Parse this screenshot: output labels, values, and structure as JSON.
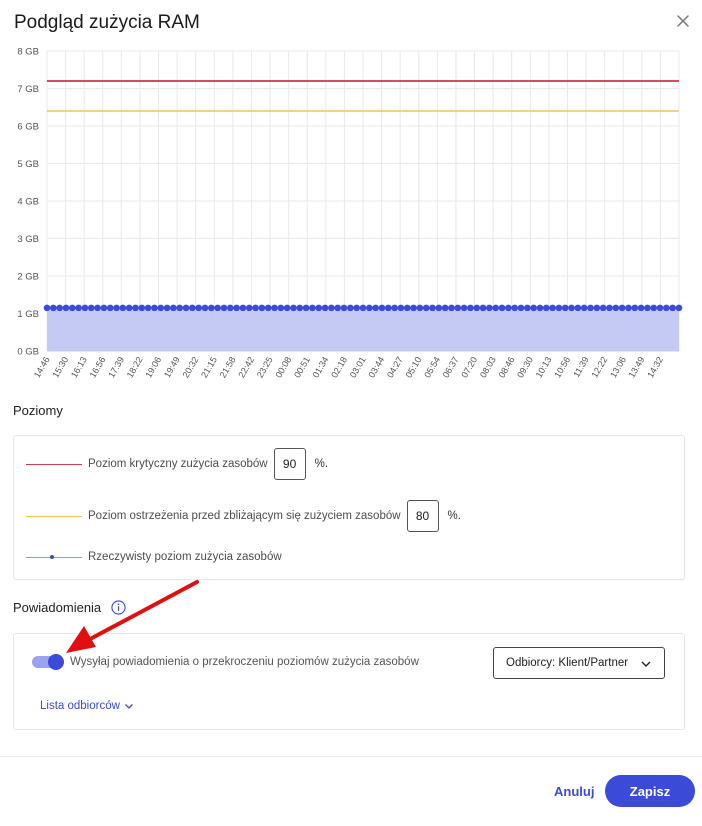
{
  "dialog": {
    "title": "Podgląd zużycia RAM",
    "close_icon": "close-icon"
  },
  "chart_data": {
    "type": "line",
    "y_ticks": [
      "0 GB",
      "1 GB",
      "2 GB",
      "3 GB",
      "4 GB",
      "5 GB",
      "6 GB",
      "7 GB",
      "8 GB"
    ],
    "ylim": [
      0,
      8
    ],
    "x_ticks": [
      "14:46",
      "15:30",
      "16:13",
      "16:56",
      "17:39",
      "18:22",
      "19:06",
      "19:49",
      "20:32",
      "21:15",
      "21:58",
      "22:42",
      "23:25",
      "00:08",
      "00:51",
      "01:34",
      "02:18",
      "03:01",
      "03:44",
      "04:27",
      "05:10",
      "05:54",
      "06:37",
      "07:20",
      "08:03",
      "08:46",
      "09:30",
      "10:13",
      "10:56",
      "11:39",
      "12:22",
      "13:06",
      "13:49",
      "14:32"
    ],
    "series": [
      {
        "name": "Poziom krytyczny zużycia zasobów",
        "kind": "threshold",
        "value": 7.2,
        "color": "#c8102e"
      },
      {
        "name": "Poziom ostrzeżenia przed zbliżającym się zużyciem zasobów",
        "kind": "threshold",
        "value": 6.4,
        "color": "#f0c060"
      },
      {
        "name": "Rzeczywisty poziom zużycia zasobów",
        "kind": "area",
        "value": 1.15,
        "points": 101,
        "color": "#3b4bd8",
        "fill": "#c5caf4"
      }
    ],
    "grid": true
  },
  "levels": {
    "title": "Poziomy",
    "critical": {
      "label": "Poziom krytyczny zużycia zasobów",
      "value": "90",
      "suffix": "%.",
      "color": "#d9394e"
    },
    "warning": {
      "label": "Poziom ostrzeżenia przed zbliżającym się zużyciem zasobów",
      "value": "80",
      "suffix": "%.",
      "color": "#f0c060"
    },
    "actual": {
      "label": "Rzeczywisty poziom zużycia zasobów",
      "color": "#8f98ec"
    }
  },
  "notifications": {
    "title": "Powiadomienia",
    "info_icon": "info-icon",
    "toggle_on": true,
    "toggle_label": "Wysyłaj powiadomienia o przekroczeniu poziomów zużycia zasobów",
    "recipients_select": "Odbiorcy: Klient/Partner",
    "recipients_link": "Lista odbiorców"
  },
  "footer": {
    "cancel": "Anuluj",
    "save": "Zapisz"
  },
  "colors": {
    "accent": "#3b4bd8",
    "critical": "#c8102e",
    "warning": "#f0c060",
    "annotation_arrow": "#e01010"
  }
}
